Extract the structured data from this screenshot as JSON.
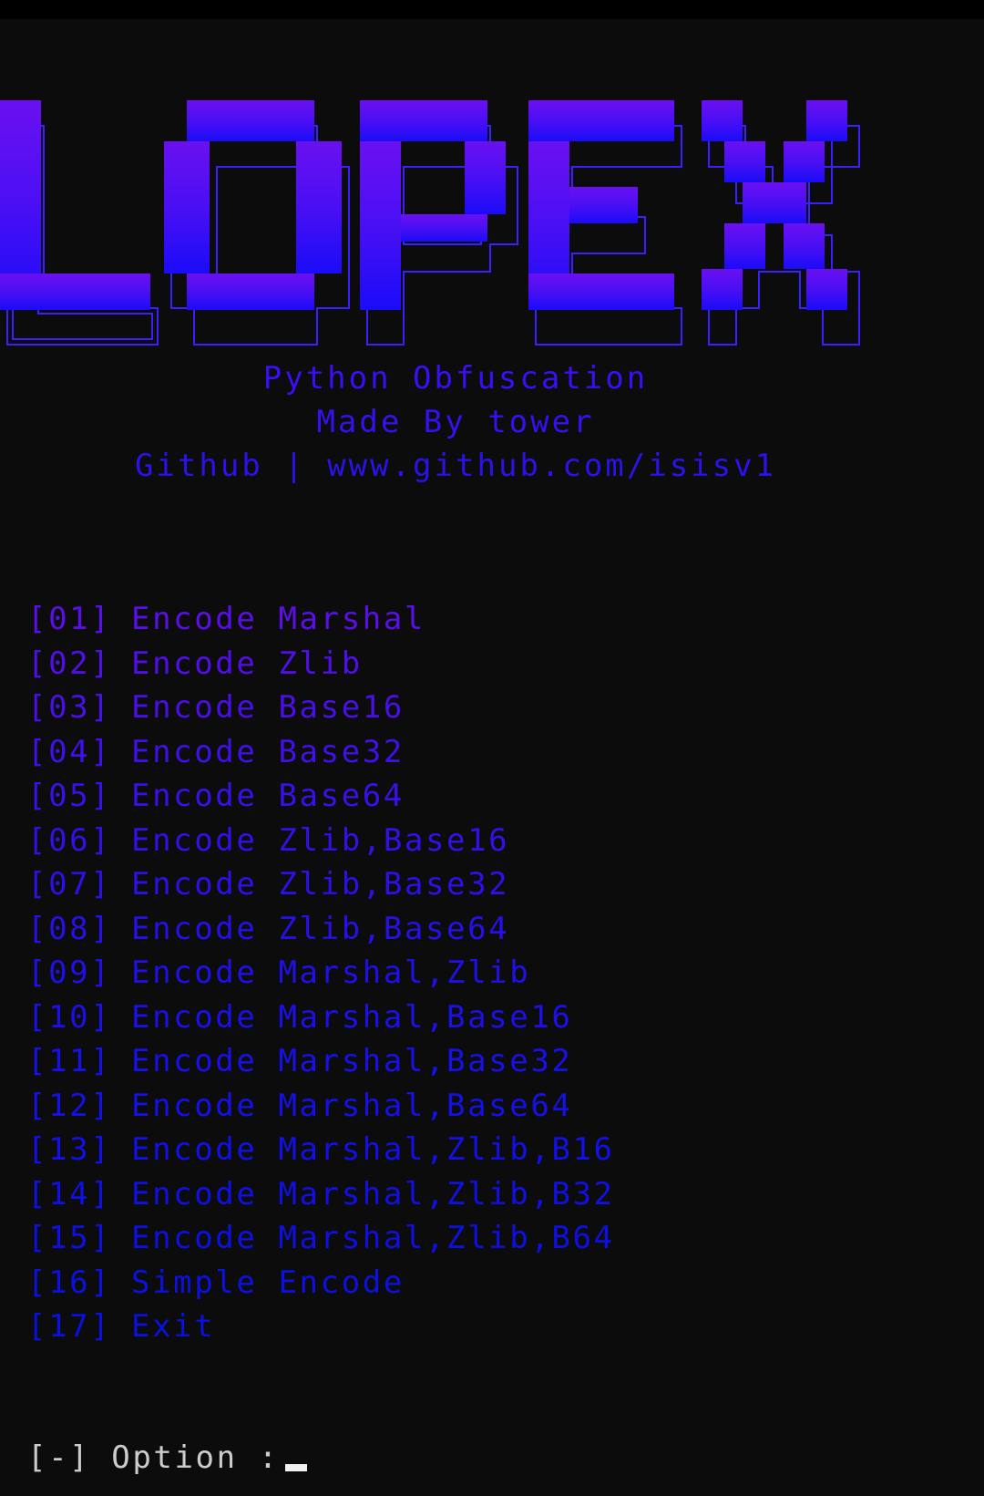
{
  "banner": {
    "text": "LOPEX",
    "gradient_top": "#6a10f0",
    "gradient_bottom": "#1a0cf8",
    "outline_color": "#3a1fff"
  },
  "subtitle": {
    "line1": "Python Obfuscation",
    "line2": "Made By tower",
    "line3": "Github | www.github.com/isisv1"
  },
  "menu": {
    "items": [
      {
        "num": "[01]",
        "label": "Encode Marshal",
        "color": "#5a0fe8"
      },
      {
        "num": "[02]",
        "label": "Encode Zlib",
        "color": "#500fe8"
      },
      {
        "num": "[03]",
        "label": "Encode Base16",
        "color": "#480fe8"
      },
      {
        "num": "[04]",
        "label": "Encode Base32",
        "color": "#4010e8"
      },
      {
        "num": "[05]",
        "label": "Encode Base64",
        "color": "#3a10e8"
      },
      {
        "num": "[06]",
        "label": "Encode Zlib,Base16",
        "color": "#3210e8"
      },
      {
        "num": "[07]",
        "label": "Encode Zlib,Base32",
        "color": "#2c10e8"
      },
      {
        "num": "[08]",
        "label": "Encode Zlib,Base64",
        "color": "#2610e8"
      },
      {
        "num": "[09]",
        "label": "Encode Marshal,Zlib",
        "color": "#2010e8"
      },
      {
        "num": "[10]",
        "label": "Encode Marshal,Base16",
        "color": "#1c10e8"
      },
      {
        "num": "[11]",
        "label": "Encode Marshal,Base32",
        "color": "#1810e8"
      },
      {
        "num": "[12]",
        "label": "Encode Marshal,Base64",
        "color": "#1510e6"
      },
      {
        "num": "[13]",
        "label": "Encode Marshal,Zlib,B16",
        "color": "#1210e6"
      },
      {
        "num": "[14]",
        "label": "Encode Marshal,Zlib,B32",
        "color": "#1010e4"
      },
      {
        "num": "[15]",
        "label": "Encode Marshal,Zlib,B64",
        "color": "#0e10e2"
      },
      {
        "num": "[16]",
        "label": "Simple Encode",
        "color": "#0c10e0"
      },
      {
        "num": "[17]",
        "label": "Exit",
        "color": "#0a10de"
      }
    ]
  },
  "prompt": {
    "text": "[-] Option :"
  }
}
